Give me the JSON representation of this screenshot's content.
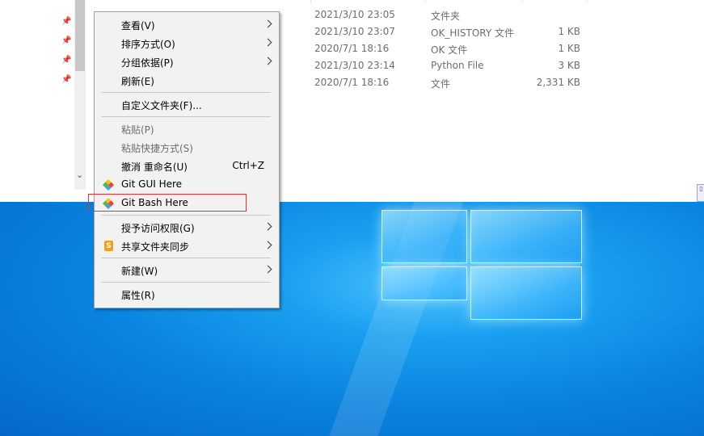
{
  "files": [
    {
      "date": "2021/3/10 23:05",
      "type": "文件夹",
      "size": ""
    },
    {
      "date": "2021/3/10 23:07",
      "type": "OK_HISTORY 文件",
      "size": "1 KB"
    },
    {
      "date": "2020/7/1 18:16",
      "type": "OK 文件",
      "size": "1 KB"
    },
    {
      "date": "2021/3/10 23:14",
      "type": "Python File",
      "size": "3 KB"
    },
    {
      "date": "2020/7/1 18:16",
      "type": "文件",
      "size": "2,331 KB"
    }
  ],
  "context_menu": {
    "view": "查看(V)",
    "sort_by": "排序方式(O)",
    "group_by": "分组依据(P)",
    "refresh": "刷新(E)",
    "customize_folder": "自定义文件夹(F)...",
    "paste": "粘贴(P)",
    "paste_shortcut": "粘贴快捷方式(S)",
    "undo_rename": "撤消 重命名(U)",
    "undo_shortcut": "Ctrl+Z",
    "git_gui": "Git GUI Here",
    "git_bash": "Git Bash Here",
    "give_access": "授予访问权限(G)",
    "share_sync": "共享文件夹同步",
    "new": "新建(W)",
    "properties": "属性(R)"
  },
  "icons": {
    "pin": "pin-icon",
    "git": "git-icon",
    "share": "share-sync-icon",
    "submenu": "chevron-right-icon"
  },
  "colors": {
    "highlight_border": "#e0302b",
    "menu_bg": "#f2f2f2",
    "desktop_blue": "#0a84df"
  }
}
